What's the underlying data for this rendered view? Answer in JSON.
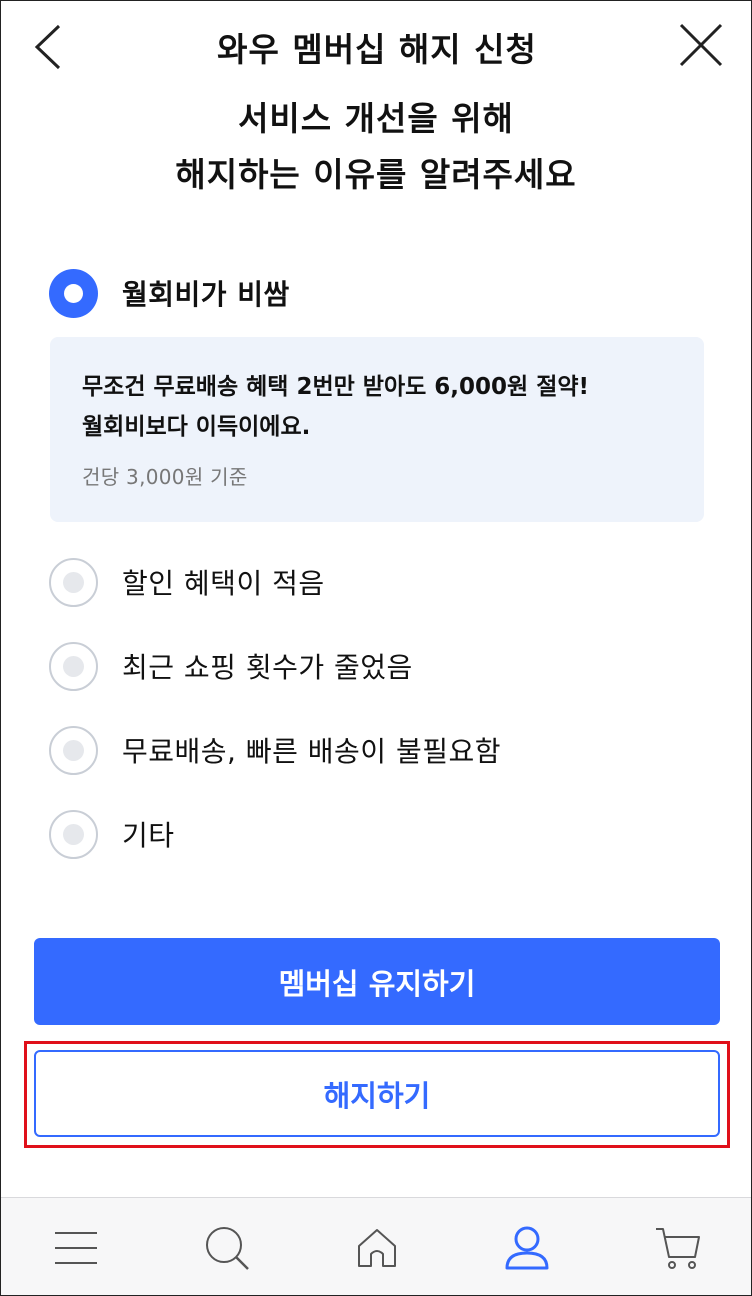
{
  "header": {
    "title": "와우 멤버십 해지 신청",
    "back_icon": "chevron-left-icon",
    "close_icon": "close-icon"
  },
  "subtitle": {
    "line1": "서비스 개선을 위해",
    "line2": "해지하는 이유를 알려주세요"
  },
  "options": [
    {
      "label": "월회비가 비쌈",
      "selected": true
    },
    {
      "label": "할인 혜택이 적음",
      "selected": false
    },
    {
      "label": "최근 쇼핑 횟수가 줄었음",
      "selected": false
    },
    {
      "label": "무료배송, 빠른 배송이 불필요함",
      "selected": false
    },
    {
      "label": "기타",
      "selected": false
    }
  ],
  "info": {
    "line1": "무조건 무료배송 혜택 2번만 받아도 6,000원 절약!",
    "line2": "월회비보다 이득이에요.",
    "note": "건당 3,000원 기준"
  },
  "buttons": {
    "keep": "멤버십 유지하기",
    "cancel": "해지하기"
  },
  "tabbar": {
    "items": [
      "menu-icon",
      "search-icon",
      "home-icon",
      "user-icon",
      "cart-icon"
    ],
    "active": "user-icon"
  },
  "colors": {
    "accent": "#346aff",
    "info_bg": "#eef3fb",
    "highlight": "#e0101a"
  }
}
